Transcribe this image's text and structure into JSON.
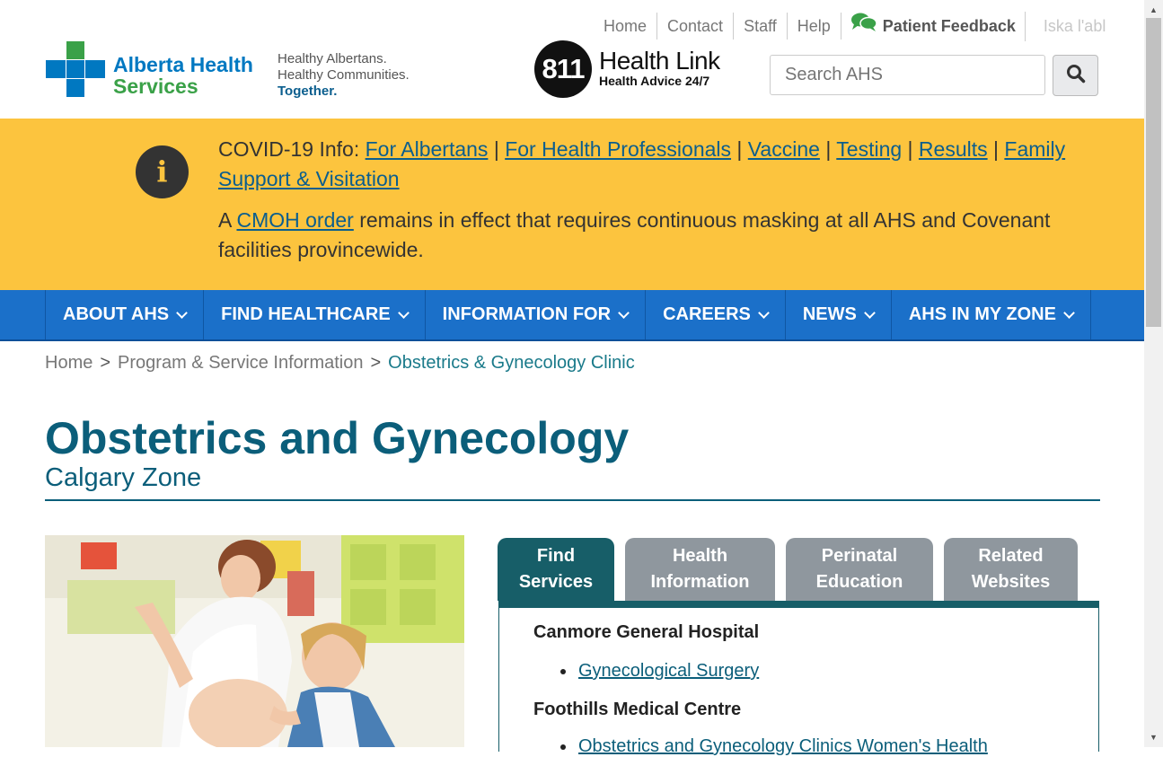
{
  "top_links": {
    "home": "Home",
    "contact": "Contact",
    "staff": "Staff",
    "help": "Help",
    "patient_feedback": "Patient Feedback",
    "language": "Iska l'abl"
  },
  "logo": {
    "line1": "Alberta Health",
    "line2": "Services"
  },
  "tagline": {
    "line1": "Healthy Albertans.",
    "line2": "Healthy Communities.",
    "line3": "Together."
  },
  "health_link": {
    "badge": "811",
    "title": "Health Link",
    "subtitle": "Health Advice 24/7"
  },
  "search": {
    "placeholder": "Search AHS"
  },
  "covid_banner": {
    "prefix": "COVID-19 Info:",
    "links": [
      "For Albertans",
      "For Health Professionals",
      "Vaccine",
      "Testing",
      "Results",
      "Family Support & Visitation"
    ],
    "separator": "|",
    "p2_before": "A",
    "p2_link": "CMOH order",
    "p2_after": "remains in effect that requires continuous masking at all AHS and Covenant facilities provincewide."
  },
  "nav": {
    "items": [
      "ABOUT AHS",
      "FIND HEALTHCARE",
      "INFORMATION FOR",
      "CAREERS",
      "NEWS",
      "AHS IN MY ZONE"
    ]
  },
  "breadcrumb": {
    "home": "Home",
    "sep": ">",
    "level1": "Program & Service Information",
    "current": "Obstetrics & Gynecology Clinic"
  },
  "page": {
    "title": "Obstetrics and Gynecology",
    "subtitle": "Calgary Zone"
  },
  "tabs": [
    {
      "line1": "Find",
      "line2": "Services"
    },
    {
      "line1": "Health",
      "line2": "Information"
    },
    {
      "line1": "Perinatal",
      "line2": "Education"
    },
    {
      "line1": "Related",
      "line2": "Websites"
    }
  ],
  "services": [
    {
      "facility": "Canmore General Hospital",
      "items": [
        "Gynecological Surgery"
      ]
    },
    {
      "facility": "Foothills Medical Centre",
      "items": [
        "Obstetrics and Gynecology Clinics Women's Health"
      ]
    }
  ],
  "colors": {
    "banner": "#fcc43e",
    "nav": "#1b70c9",
    "accent": "#0b5e7a",
    "tab_active": "#175e68",
    "tab_inactive": "#8f979e"
  }
}
